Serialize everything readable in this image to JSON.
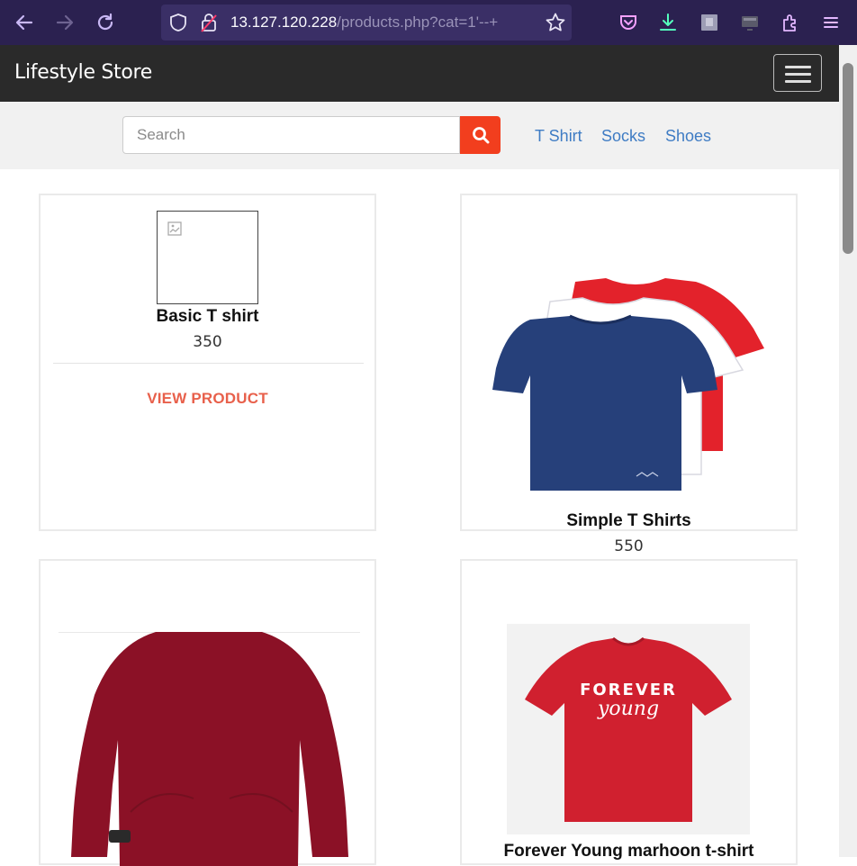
{
  "browser": {
    "url_host": "13.127.120.228",
    "url_path": "/products.php?cat=1'--+"
  },
  "site": {
    "brand": "Lifestyle Store"
  },
  "search": {
    "placeholder": "Search"
  },
  "categories": [
    "T Shirt",
    "Socks",
    "Shoes"
  ],
  "products": [
    {
      "name": "Basic T shirt",
      "price": "350",
      "action": "VIEW PRODUCT"
    },
    {
      "name": "Simple T Shirts",
      "price": "550"
    },
    {
      "name": ""
    },
    {
      "name": "Forever Young marhoon t-shirt"
    }
  ],
  "tshirt_print": {
    "line1": "FOREVER",
    "line2": "young"
  },
  "colors": {
    "browser_bg": "#2b2150",
    "navbar_bg": "#2a2a2a",
    "search_button": "#f23e1e",
    "category_link": "#3f7cc4",
    "view_product": "#e8604b"
  },
  "icons": [
    "back-arrow-icon",
    "forward-arrow-icon",
    "reload-icon",
    "shield-icon",
    "lock-icon",
    "bookmark-star-icon",
    "pocket-icon",
    "download-icon",
    "extension-icon",
    "menu-icon",
    "search-icon",
    "broken-image-icon"
  ]
}
